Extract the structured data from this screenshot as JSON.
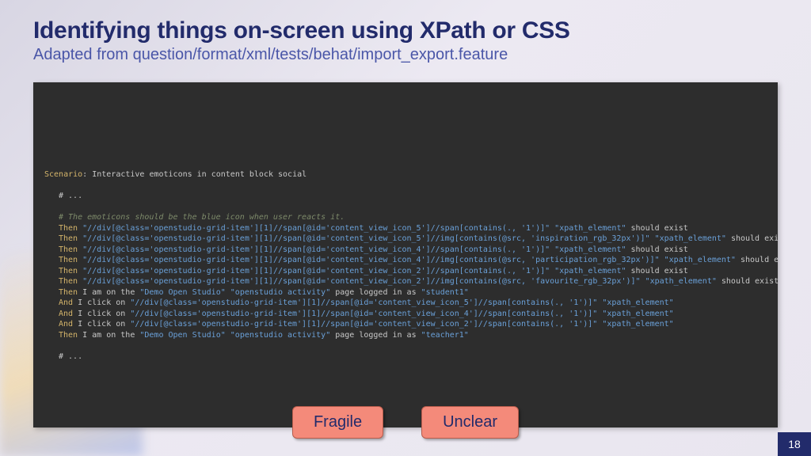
{
  "title": "Identifying things on-screen using XPath or CSS",
  "subtitle": "Adapted from question/format/xml/tests/behat/import_export.feature",
  "page_number": "18",
  "buttons": {
    "fragile": "Fragile",
    "unclear": "Unclear"
  },
  "code": {
    "scenario_kw": "Scenario",
    "scenario_text": ": Interactive emoticons in content block social",
    "ellipsis": "# ...",
    "comment": "# The emoticons should be the blue icon when user reacts it.",
    "lines": [
      {
        "kw": "Then",
        "pre": " ",
        "str": "\"//div[@class='openstudio-grid-item'][1]//span[@id='content_view_icon_5']//span[contains(., '1')]\"",
        "mid": " ",
        "str2": "\"xpath_element\"",
        "post": " should exist"
      },
      {
        "kw": "Then",
        "pre": " ",
        "str": "\"//div[@class='openstudio-grid-item'][1]//span[@id='content_view_icon_5']//img[contains(@src, 'inspiration_rgb_32px')]\"",
        "mid": " ",
        "str2": "\"xpath_element\"",
        "post": " should exist"
      },
      {
        "kw": "Then",
        "pre": " ",
        "str": "\"//div[@class='openstudio-grid-item'][1]//span[@id='content_view_icon_4']//span[contains(., '1')]\"",
        "mid": " ",
        "str2": "\"xpath_element\"",
        "post": " should exist"
      },
      {
        "kw": "Then",
        "pre": " ",
        "str": "\"//div[@class='openstudio-grid-item'][1]//span[@id='content_view_icon_4']//img[contains(@src, 'participation_rgb_32px')]\"",
        "mid": " ",
        "str2": "\"xpath_element\"",
        "post": " should exist"
      },
      {
        "kw": "Then",
        "pre": " ",
        "str": "\"//div[@class='openstudio-grid-item'][1]//span[@id='content_view_icon_2']//span[contains(., '1')]\"",
        "mid": " ",
        "str2": "\"xpath_element\"",
        "post": " should exist"
      },
      {
        "kw": "Then",
        "pre": " ",
        "str": "\"//div[@class='openstudio-grid-item'][1]//span[@id='content_view_icon_2']//img[contains(@src, 'favourite_rgb_32px')]\"",
        "mid": " ",
        "str2": "\"xpath_element\"",
        "post": " should exist"
      },
      {
        "kw": "Then",
        "pre": " I am on the ",
        "str": "\"Demo Open Studio\"",
        "mid": " ",
        "str2": "\"openstudio activity\"",
        "post": " page logged in as ",
        "str3": "\"student1\""
      },
      {
        "kw": "And",
        "pre": " I click on ",
        "str": "\"//div[@class='openstudio-grid-item'][1]//span[@id='content_view_icon_5']//span[contains(., '1')]\"",
        "mid": " ",
        "str2": "\"xpath_element\"",
        "post": ""
      },
      {
        "kw": "And",
        "pre": " I click on ",
        "str": "\"//div[@class='openstudio-grid-item'][1]//span[@id='content_view_icon_4']//span[contains(., '1')]\"",
        "mid": " ",
        "str2": "\"xpath_element\"",
        "post": ""
      },
      {
        "kw": "And",
        "pre": " I click on ",
        "str": "\"//div[@class='openstudio-grid-item'][1]//span[@id='content_view_icon_2']//span[contains(., '1')]\"",
        "mid": " ",
        "str2": "\"xpath_element\"",
        "post": ""
      },
      {
        "kw": "Then",
        "pre": " I am on the ",
        "str": "\"Demo Open Studio\"",
        "mid": " ",
        "str2": "\"openstudio activity\"",
        "post": " page logged in as ",
        "str3": "\"teacher1\""
      }
    ]
  }
}
